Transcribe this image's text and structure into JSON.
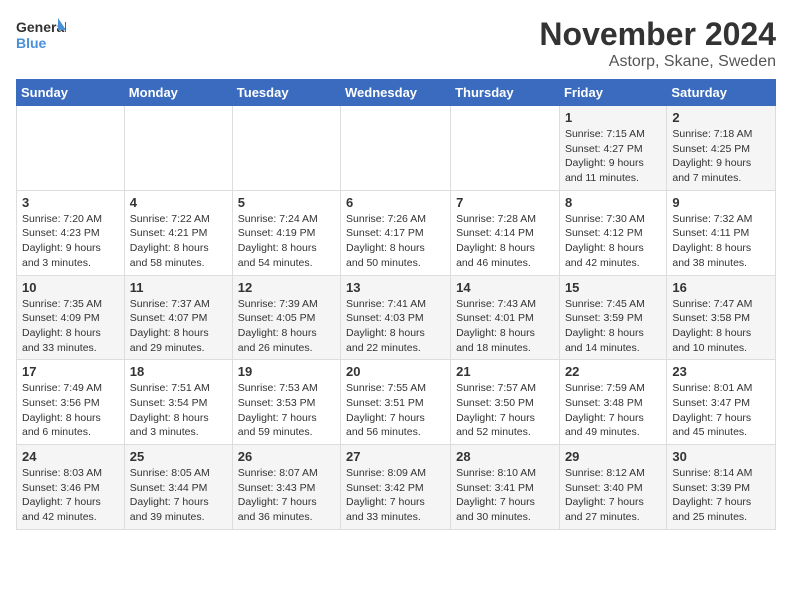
{
  "logo": {
    "text_general": "General",
    "text_blue": "Blue"
  },
  "title": "November 2024",
  "subtitle": "Astorp, Skane, Sweden",
  "days_of_week": [
    "Sunday",
    "Monday",
    "Tuesday",
    "Wednesday",
    "Thursday",
    "Friday",
    "Saturday"
  ],
  "weeks": [
    [
      {
        "day": "",
        "info": ""
      },
      {
        "day": "",
        "info": ""
      },
      {
        "day": "",
        "info": ""
      },
      {
        "day": "",
        "info": ""
      },
      {
        "day": "",
        "info": ""
      },
      {
        "day": "1",
        "info": "Sunrise: 7:15 AM\nSunset: 4:27 PM\nDaylight: 9 hours and 11 minutes."
      },
      {
        "day": "2",
        "info": "Sunrise: 7:18 AM\nSunset: 4:25 PM\nDaylight: 9 hours and 7 minutes."
      }
    ],
    [
      {
        "day": "3",
        "info": "Sunrise: 7:20 AM\nSunset: 4:23 PM\nDaylight: 9 hours and 3 minutes."
      },
      {
        "day": "4",
        "info": "Sunrise: 7:22 AM\nSunset: 4:21 PM\nDaylight: 8 hours and 58 minutes."
      },
      {
        "day": "5",
        "info": "Sunrise: 7:24 AM\nSunset: 4:19 PM\nDaylight: 8 hours and 54 minutes."
      },
      {
        "day": "6",
        "info": "Sunrise: 7:26 AM\nSunset: 4:17 PM\nDaylight: 8 hours and 50 minutes."
      },
      {
        "day": "7",
        "info": "Sunrise: 7:28 AM\nSunset: 4:14 PM\nDaylight: 8 hours and 46 minutes."
      },
      {
        "day": "8",
        "info": "Sunrise: 7:30 AM\nSunset: 4:12 PM\nDaylight: 8 hours and 42 minutes."
      },
      {
        "day": "9",
        "info": "Sunrise: 7:32 AM\nSunset: 4:11 PM\nDaylight: 8 hours and 38 minutes."
      }
    ],
    [
      {
        "day": "10",
        "info": "Sunrise: 7:35 AM\nSunset: 4:09 PM\nDaylight: 8 hours and 33 minutes."
      },
      {
        "day": "11",
        "info": "Sunrise: 7:37 AM\nSunset: 4:07 PM\nDaylight: 8 hours and 29 minutes."
      },
      {
        "day": "12",
        "info": "Sunrise: 7:39 AM\nSunset: 4:05 PM\nDaylight: 8 hours and 26 minutes."
      },
      {
        "day": "13",
        "info": "Sunrise: 7:41 AM\nSunset: 4:03 PM\nDaylight: 8 hours and 22 minutes."
      },
      {
        "day": "14",
        "info": "Sunrise: 7:43 AM\nSunset: 4:01 PM\nDaylight: 8 hours and 18 minutes."
      },
      {
        "day": "15",
        "info": "Sunrise: 7:45 AM\nSunset: 3:59 PM\nDaylight: 8 hours and 14 minutes."
      },
      {
        "day": "16",
        "info": "Sunrise: 7:47 AM\nSunset: 3:58 PM\nDaylight: 8 hours and 10 minutes."
      }
    ],
    [
      {
        "day": "17",
        "info": "Sunrise: 7:49 AM\nSunset: 3:56 PM\nDaylight: 8 hours and 6 minutes."
      },
      {
        "day": "18",
        "info": "Sunrise: 7:51 AM\nSunset: 3:54 PM\nDaylight: 8 hours and 3 minutes."
      },
      {
        "day": "19",
        "info": "Sunrise: 7:53 AM\nSunset: 3:53 PM\nDaylight: 7 hours and 59 minutes."
      },
      {
        "day": "20",
        "info": "Sunrise: 7:55 AM\nSunset: 3:51 PM\nDaylight: 7 hours and 56 minutes."
      },
      {
        "day": "21",
        "info": "Sunrise: 7:57 AM\nSunset: 3:50 PM\nDaylight: 7 hours and 52 minutes."
      },
      {
        "day": "22",
        "info": "Sunrise: 7:59 AM\nSunset: 3:48 PM\nDaylight: 7 hours and 49 minutes."
      },
      {
        "day": "23",
        "info": "Sunrise: 8:01 AM\nSunset: 3:47 PM\nDaylight: 7 hours and 45 minutes."
      }
    ],
    [
      {
        "day": "24",
        "info": "Sunrise: 8:03 AM\nSunset: 3:46 PM\nDaylight: 7 hours and 42 minutes."
      },
      {
        "day": "25",
        "info": "Sunrise: 8:05 AM\nSunset: 3:44 PM\nDaylight: 7 hours and 39 minutes."
      },
      {
        "day": "26",
        "info": "Sunrise: 8:07 AM\nSunset: 3:43 PM\nDaylight: 7 hours and 36 minutes."
      },
      {
        "day": "27",
        "info": "Sunrise: 8:09 AM\nSunset: 3:42 PM\nDaylight: 7 hours and 33 minutes."
      },
      {
        "day": "28",
        "info": "Sunrise: 8:10 AM\nSunset: 3:41 PM\nDaylight: 7 hours and 30 minutes."
      },
      {
        "day": "29",
        "info": "Sunrise: 8:12 AM\nSunset: 3:40 PM\nDaylight: 7 hours and 27 minutes."
      },
      {
        "day": "30",
        "info": "Sunrise: 8:14 AM\nSunset: 3:39 PM\nDaylight: 7 hours and 25 minutes."
      }
    ]
  ]
}
